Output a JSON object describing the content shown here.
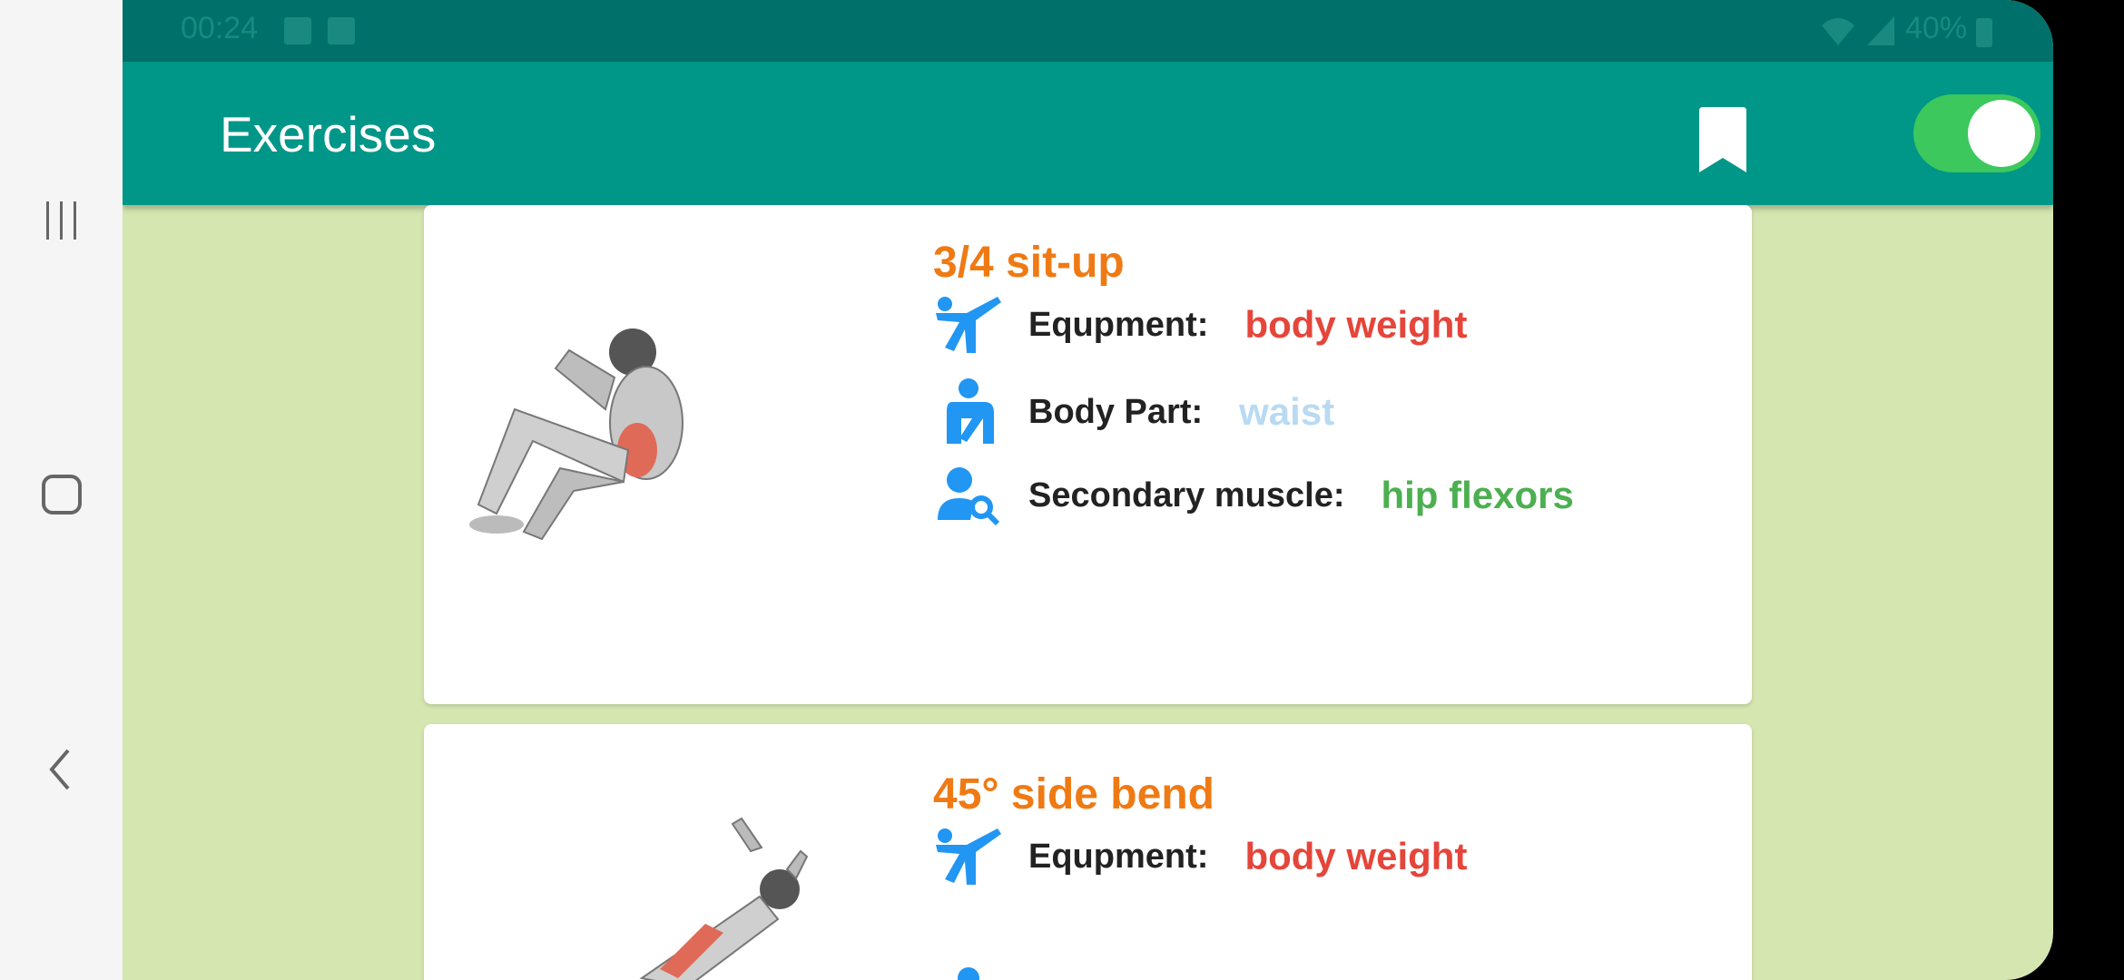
{
  "status_bar": {
    "time": "00:24",
    "battery": "40%"
  },
  "app_bar": {
    "title": "Exercises"
  },
  "exercises": [
    {
      "name": "3/4 sit-up",
      "equipment_label": "Equpment:",
      "equipment": "body weight",
      "body_part_label": "Body Part:",
      "body_part": "waist",
      "secondary_label": "Secondary muscle:",
      "secondary": "hip flexors"
    },
    {
      "name": "45° side bend",
      "equipment_label": "Equpment:",
      "equipment": "body weight"
    }
  ],
  "colors": {
    "app_bar": "#009688",
    "status_bar": "#00706a",
    "background": "#d5e6b0",
    "title": "#ef7a14",
    "equipment_value": "#e5453a",
    "body_part_value": "#b8daf2",
    "secondary_value": "#4caf50",
    "icon": "#2196f3",
    "toggle": "#3cc85c"
  },
  "icons": [
    "recent-apps-icon",
    "home-icon",
    "back-icon",
    "bookmark-icon",
    "martial-arts-icon",
    "body-part-icon",
    "person-search-icon"
  ]
}
